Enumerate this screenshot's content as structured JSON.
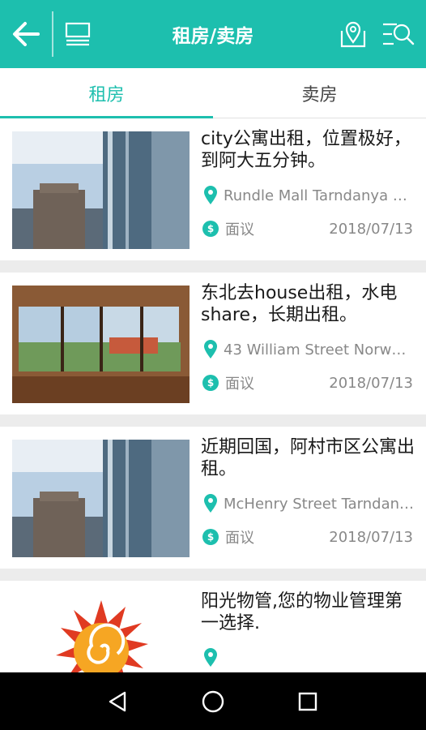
{
  "appbar": {
    "title": "租房/卖房",
    "accent": "#1dbfae"
  },
  "tabs": [
    {
      "label": "租房",
      "active": true
    },
    {
      "label": "卖房",
      "active": false
    }
  ],
  "listings": [
    {
      "title": "city公寓出租，位置极好，到阿大五分钟。",
      "address": "Rundle Mall Tarndanya …",
      "price": "面议",
      "date": "2018/07/13",
      "image": "building-photo"
    },
    {
      "title": "东北去house出租，水电share，长期出租。",
      "address": "43 William Street Norwo…",
      "price": "面议",
      "date": "2018/07/13",
      "image": "room-corner-window-photo"
    },
    {
      "title": "近期回国，阿村市区公寓出租。",
      "address": "McHenry Street Tarndan…",
      "price": "面议",
      "date": "2018/07/13",
      "image": "building-photo"
    },
    {
      "title": "阳光物管,您的物业管理第一选择.",
      "address": "",
      "price": "",
      "date": "",
      "image": "sun-logo"
    }
  ],
  "icons": {
    "back": "arrow-left-icon",
    "list": "list-view-icon",
    "map": "map-pin-icon",
    "filter": "search-filter-icon",
    "location": "location-pin-icon",
    "price": "dollar-coin-icon",
    "nav_back": "triangle-back-icon",
    "nav_home": "circle-home-icon",
    "nav_recents": "square-recents-icon"
  }
}
